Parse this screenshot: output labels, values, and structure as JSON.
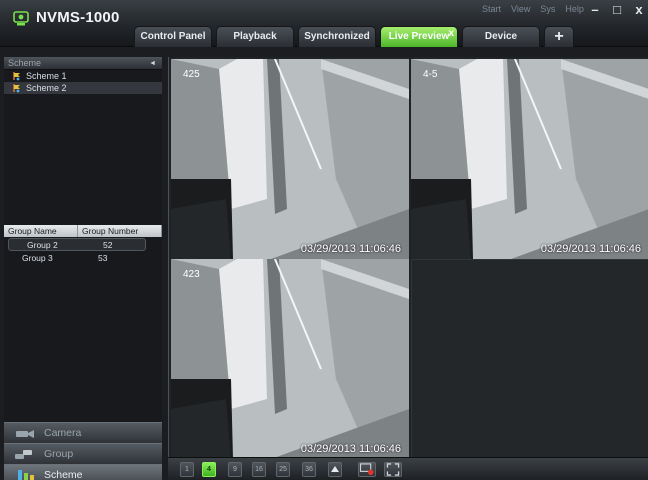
{
  "app": {
    "title": "NVMS-1000"
  },
  "tabs": [
    {
      "label": "Control Panel"
    },
    {
      "label": "Playback"
    },
    {
      "label": "Synchronized"
    },
    {
      "label": "Live Preview",
      "active": true
    },
    {
      "label": "Device"
    }
  ],
  "tab_add_label": "+",
  "tab_close_label": "x",
  "top_menu": [
    "Start",
    "View",
    "Sys",
    "Help"
  ],
  "window_controls": {
    "minimize": "–",
    "maximize": "□",
    "close": "x"
  },
  "scheme_panel": {
    "header": "Scheme",
    "collapse_glyph": "◄",
    "items": [
      {
        "label": "Scheme 1"
      },
      {
        "label": "Scheme 2",
        "selected": true
      }
    ]
  },
  "group_table": {
    "columns": [
      "Group Name",
      "Group Number"
    ],
    "rows": [
      {
        "name": "Group 2",
        "number": "52",
        "selected": true
      },
      {
        "name": "Group 3",
        "number": "53"
      }
    ]
  },
  "nav": [
    {
      "label": "Camera"
    },
    {
      "label": "Group"
    },
    {
      "label": "Scheme",
      "active": true
    }
  ],
  "video_cells": [
    {
      "camera": "425",
      "timestamp": "03/29/2013 11:06:46",
      "selected": true
    },
    {
      "camera": "4-5",
      "timestamp": "03/29/2013 11:06:46"
    },
    {
      "camera": "423",
      "timestamp": "03/29/2013 11:06:46"
    },
    {
      "camera": "",
      "timestamp": ""
    }
  ],
  "toolbar": {
    "layouts": [
      "1",
      "4",
      "9",
      "16",
      "25",
      "36"
    ],
    "active_layout": "4"
  },
  "colors": {
    "accent": "#51e032",
    "tab_active": "#6fd443"
  }
}
